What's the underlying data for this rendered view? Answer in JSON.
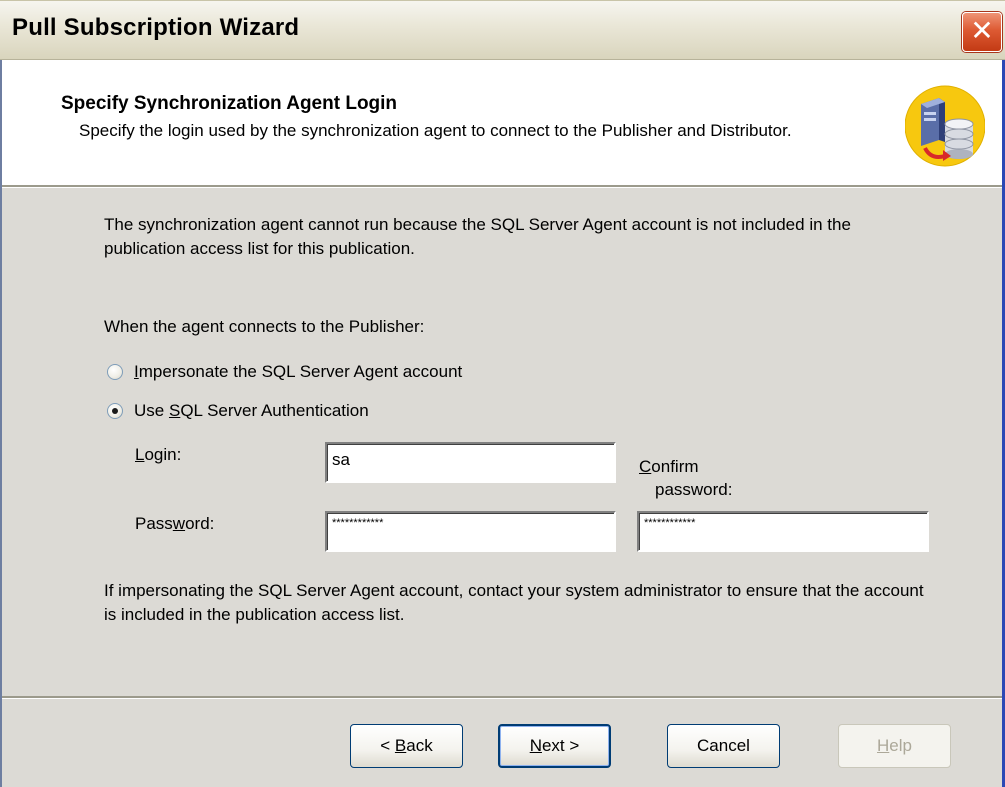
{
  "window": {
    "title": "Pull Subscription Wizard",
    "close_glyph": "✕"
  },
  "header": {
    "step_title": "Specify Synchronization Agent Login",
    "step_description": "Specify the login used by the synchronization agent to connect to the Publisher and Distributor.",
    "icon": "database-agent-icon"
  },
  "body": {
    "message": "The synchronization agent cannot run because the SQL Server Agent account is not included in the publication access list for this publication.",
    "connects_label": "When the agent connects to the Publisher:",
    "options": [
      {
        "mnemonic": "I",
        "label_rest": "mpersonate the SQL Server Agent account",
        "selected": false
      },
      {
        "prefix": "Use ",
        "mnemonic": "S",
        "label_rest": "QL Server Authentication",
        "selected": true
      }
    ],
    "login": {
      "mnemonic": "L",
      "label_rest": "ogin:",
      "value": "sa"
    },
    "password": {
      "label_prefix": "Pass",
      "mnemonic": "w",
      "label_rest": "ord:",
      "value": "************"
    },
    "confirm": {
      "mnemonic": "C",
      "label_rest": "onfirm",
      "label_line2": "password:",
      "value": "************"
    },
    "note": "If impersonating the SQL Server Agent account, contact your system administrator to ensure that the account is included in the publication access list."
  },
  "buttons": {
    "back": {
      "prefix": "< ",
      "mnemonic": "B",
      "rest": "ack"
    },
    "next": {
      "mnemonic": "N",
      "rest": "ext >"
    },
    "cancel": "Cancel",
    "help": {
      "mnemonic": "H",
      "rest": "elp",
      "enabled": false
    }
  },
  "colors": {
    "title_bar": "#e9e6d6",
    "dialog_body": "#dcdad5",
    "header_band": "#ffffff",
    "close_button": "#dd5a33",
    "button_border": "#003c74",
    "icon_circle": "#f7c80f"
  }
}
